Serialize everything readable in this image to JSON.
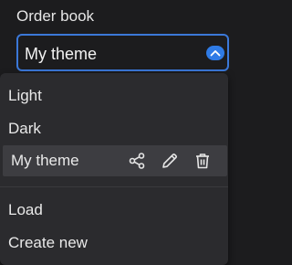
{
  "section": {
    "label": "Order book"
  },
  "select": {
    "value": "My theme"
  },
  "menu": {
    "items": [
      {
        "label": "Light"
      },
      {
        "label": "Dark"
      },
      {
        "label": "My theme",
        "selected": true,
        "actions": [
          "share-icon",
          "pencil-icon",
          "trash-icon"
        ]
      }
    ],
    "footer_items": [
      {
        "label": "Load"
      },
      {
        "label": "Create new"
      }
    ]
  },
  "colors": {
    "background": "#1c1c1e",
    "dropdown": "#2b2b2e",
    "selected_row": "#3d3d41",
    "accent": "#2f7be6",
    "focus_border": "#3b78d8"
  }
}
